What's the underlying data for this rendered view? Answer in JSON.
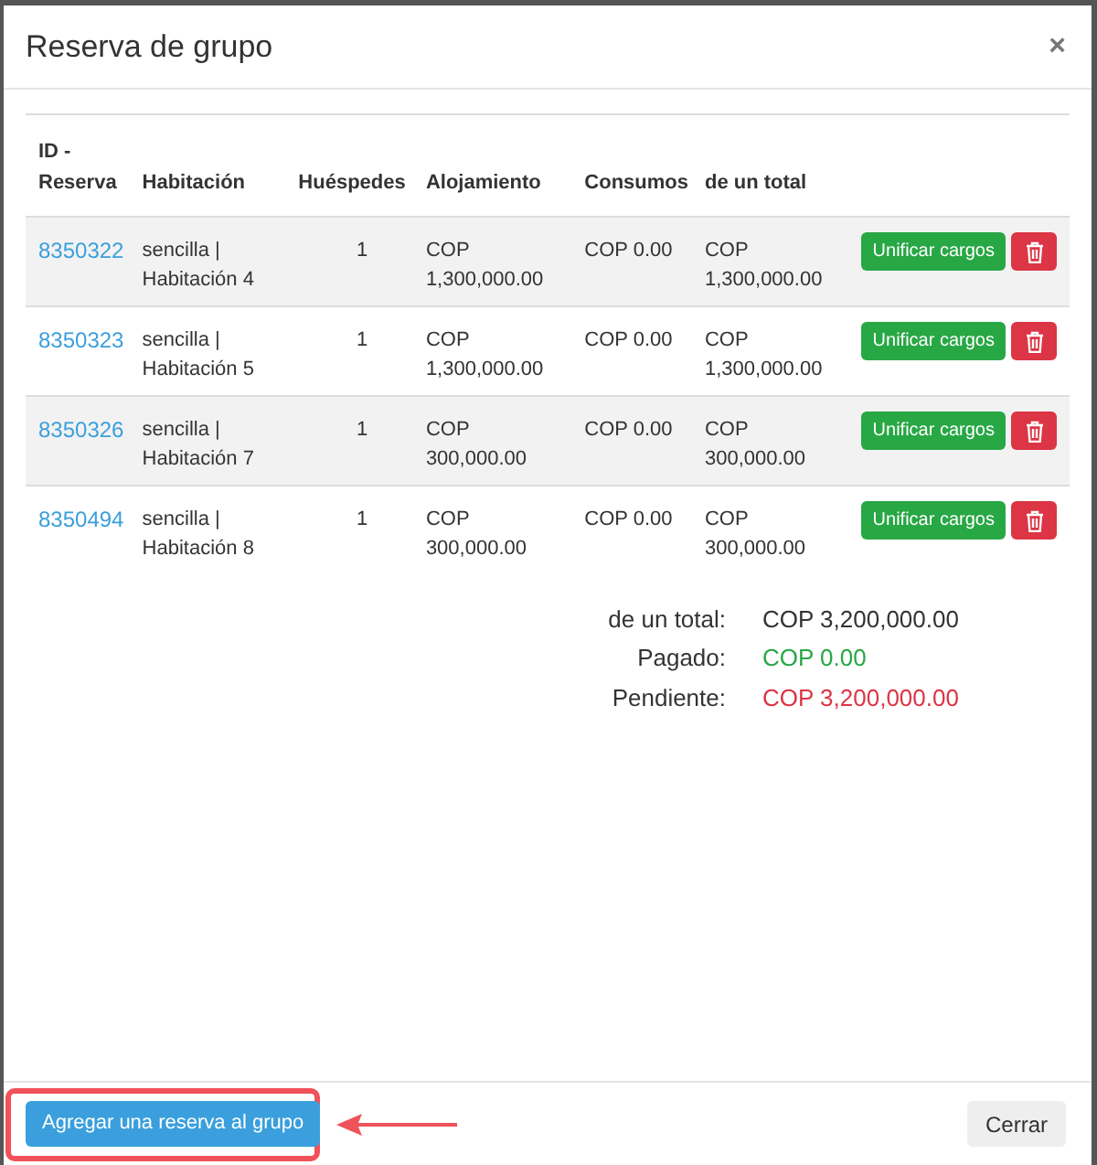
{
  "modal": {
    "title": "Reserva de grupo",
    "close": "×"
  },
  "table": {
    "columns": [
      "ID - Reserva",
      "Habitación",
      "Huéspedes",
      "Alojamiento",
      "Consumos",
      "de un total"
    ],
    "rows": [
      {
        "id": "8350322",
        "room": "sencilla | Habitación 4",
        "guests": "1",
        "lodging": "COP 1,300,000.00",
        "consumption": "COP 0.00",
        "total": "COP 1,300,000.00",
        "merge": "Unificar cargos"
      },
      {
        "id": "8350323",
        "room": "sencilla | Habitación 5",
        "guests": "1",
        "lodging": "COP 1,300,000.00",
        "consumption": "COP 0.00",
        "total": "COP 1,300,000.00",
        "merge": "Unificar cargos"
      },
      {
        "id": "8350326",
        "room": "sencilla | Habitación 7",
        "guests": "1",
        "lodging": "COP 300,000.00",
        "consumption": "COP 0.00",
        "total": "COP 300,000.00",
        "merge": "Unificar cargos"
      },
      {
        "id": "8350494",
        "room": "sencilla | Habitación 8",
        "guests": "1",
        "lodging": "COP 300,000.00",
        "consumption": "COP 0.00",
        "total": "COP 300,000.00",
        "merge": "Unificar cargos"
      }
    ]
  },
  "summary": [
    {
      "label": "de un total:",
      "value": "COP 3,200,000.00",
      "color": "#333333"
    },
    {
      "label": "Pagado:",
      "value": "COP 0.00",
      "color": "#28a745"
    },
    {
      "label": "Pendiente:",
      "value": "COP 3,200,000.00",
      "color": "#dc3545"
    }
  ],
  "footer": {
    "add_button": "Agregar una reserva al grupo",
    "close_button": "Cerrar"
  }
}
